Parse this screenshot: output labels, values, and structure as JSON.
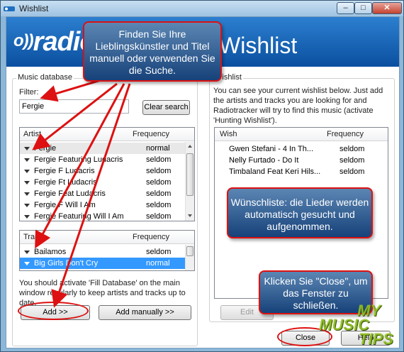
{
  "window": {
    "title": "Wishlist",
    "controls": {
      "minimize": "–",
      "maximize": "□",
      "close": "✕"
    }
  },
  "banner": {
    "logo": "radio",
    "title": "Wishlist"
  },
  "music_database": {
    "group_label": "Music database",
    "filter_label": "Filter:",
    "filter_value": "Fergie",
    "clear_search": "Clear search",
    "artist_list": {
      "headers": [
        "Artist",
        "Frequency"
      ],
      "rows": [
        {
          "name": "Fergie",
          "frequency": "normal"
        },
        {
          "name": "Fergie Featuring Ludacris",
          "frequency": "seldom"
        },
        {
          "name": "Fergie F Ludacris",
          "frequency": "seldom"
        },
        {
          "name": "Fergie Ft Ludacris",
          "frequency": "seldom"
        },
        {
          "name": "Fergie Feat Ludacris",
          "frequency": "seldom"
        },
        {
          "name": "Fergie F Will I Am",
          "frequency": "seldom"
        },
        {
          "name": "Fergie Featuring Will I Am",
          "frequency": "seldom"
        }
      ]
    },
    "track_list": {
      "headers": [
        "Track",
        "Frequency"
      ],
      "rows": [
        {
          "name": "Bailamos",
          "frequency": "seldom"
        },
        {
          "name": "Big Girls Don't Cry",
          "frequency": "normal"
        }
      ]
    },
    "hint": "You should activate 'Fill Database' on the main window regularly to keep artists and tracks up to date.",
    "add_button": "Add >>",
    "add_manually_button": "Add manually >>"
  },
  "wishlist": {
    "group_label": "Wishlist",
    "description": "You can see your current wishlist below. Just add the artists and tracks you are looking for and Radiotracker will try to find this music (activate 'Hunting Wishlist').",
    "headers": [
      "Wish",
      "Frequency"
    ],
    "rows": [
      {
        "name": "Gwen Stefani - 4 In Th...",
        "frequency": "seldom"
      },
      {
        "name": "Nelly Furtado - Do It",
        "frequency": "seldom"
      },
      {
        "name": "Timbaland Feat Keri Hils...",
        "frequency": "seldom"
      }
    ],
    "edit_button": "Edit",
    "close_button": "Close",
    "help_button": "Help"
  },
  "callouts": {
    "search_tip": "Finden Sie Ihre Lieblingskünstler und Titel   manuell oder verwenden Sie die Suche.",
    "wishlist_tip": "Wünschliste: die Lieder werden automatisch gesucht und aufgenommen.",
    "close_tip": "Klicken Sie \"Close\", um das Fenster zu schließen."
  },
  "watermark": {
    "line1": "MY",
    "line2": "MUSIC",
    "line3": "TIPS"
  },
  "colors": {
    "accent": "#3399ff",
    "callout_border": "#dd1111",
    "banner": "#0b4f9f"
  }
}
